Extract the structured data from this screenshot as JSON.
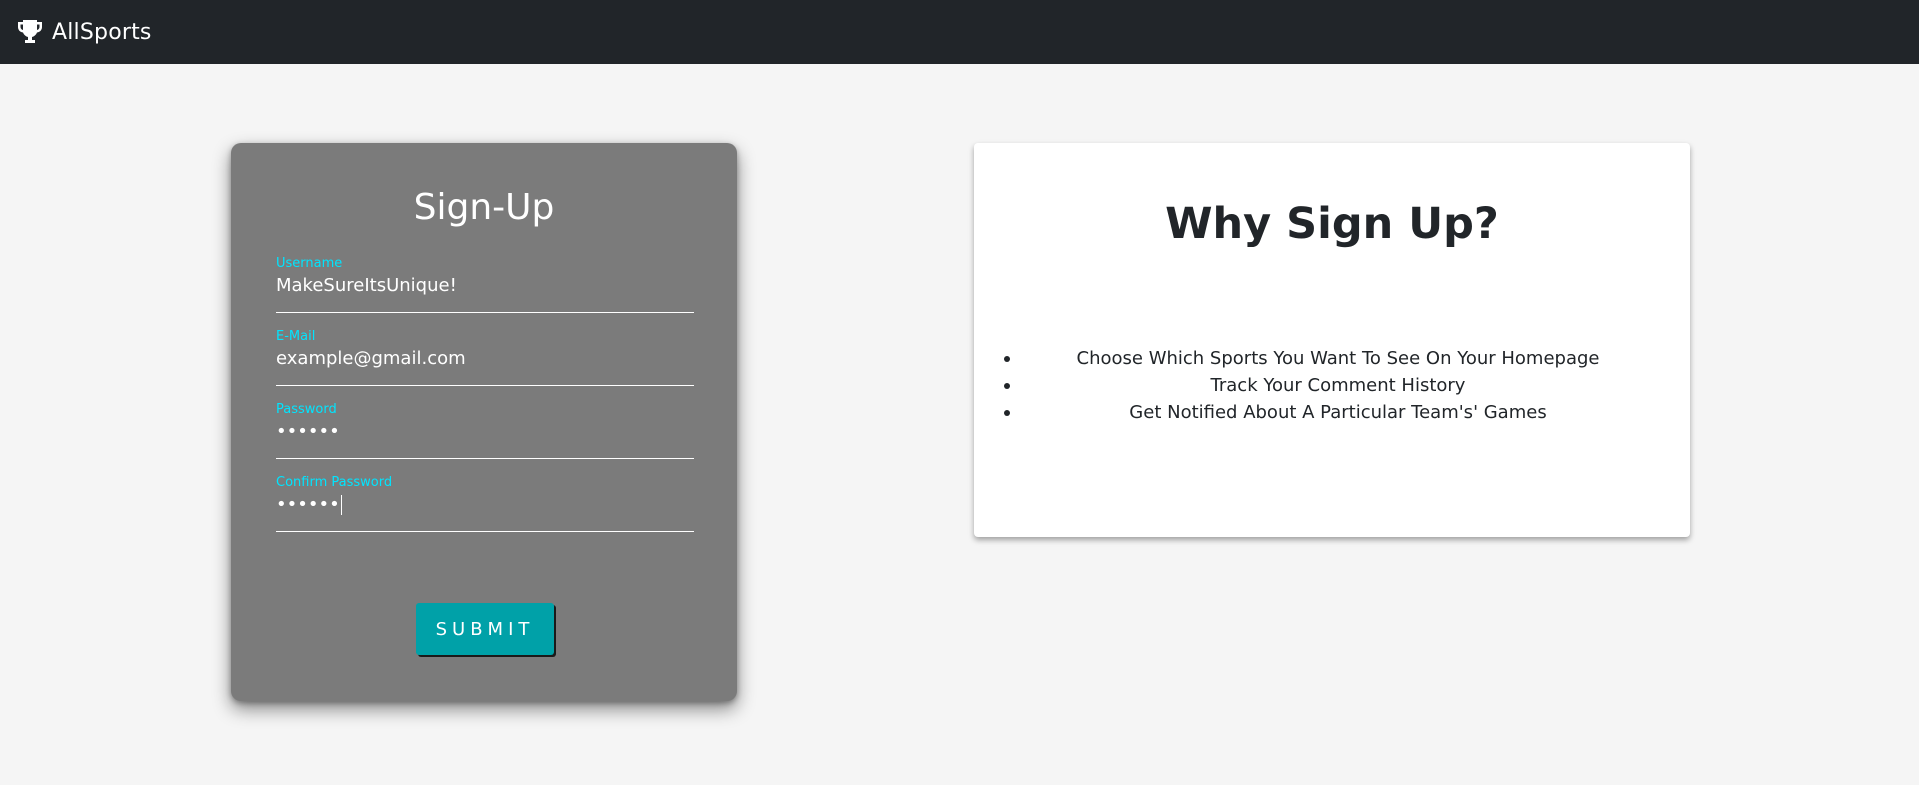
{
  "navbar": {
    "brand": "AllSports",
    "icon": "trophy-icon"
  },
  "signup": {
    "title": "Sign-Up",
    "fields": [
      {
        "label": "Username",
        "value": "MakeSureItsUnique!"
      },
      {
        "label": "E-Mail",
        "value": "example@gmail.com"
      },
      {
        "label": "Password",
        "value": "••••••"
      },
      {
        "label": "Confirm Password",
        "value": "••••••"
      }
    ],
    "submit_label": "SUBMIT"
  },
  "why": {
    "title": "Why Sign Up?",
    "items": [
      "Choose Which Sports You Want To See On Your Homepage",
      "Track Your Comment History",
      "Get Notified About A Particular Team's' Games"
    ]
  },
  "colors": {
    "navbar": "#212529",
    "card": "#7b7b7b",
    "label_accent": "#00e5ff",
    "button": "#00a1a8"
  }
}
